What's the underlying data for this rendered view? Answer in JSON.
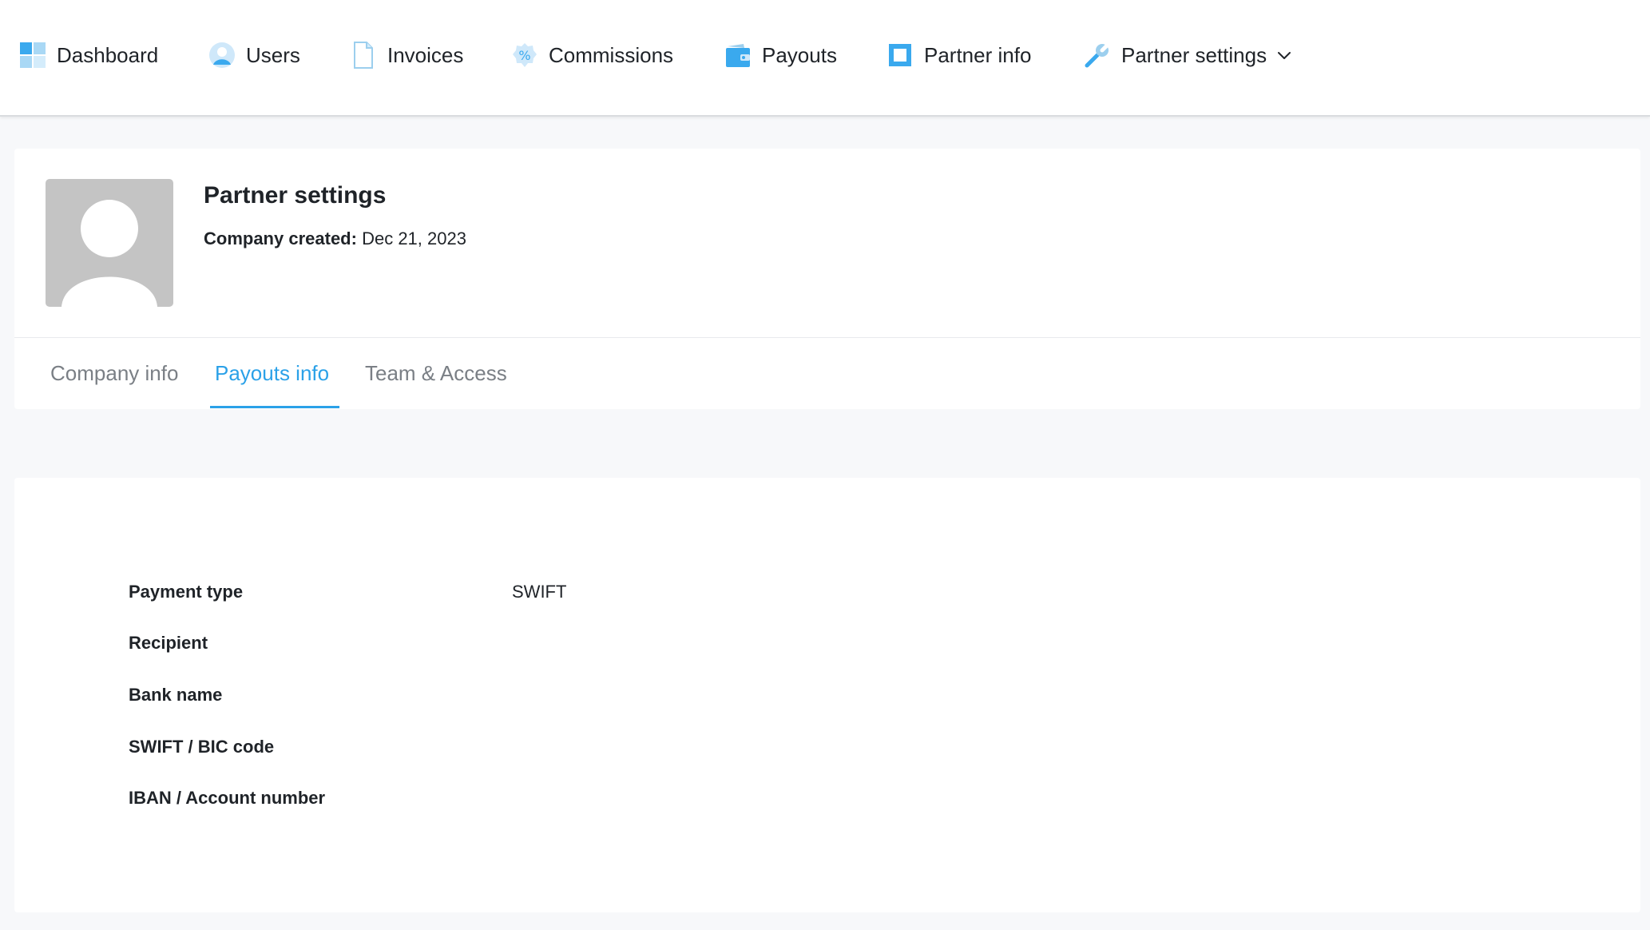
{
  "nav": {
    "items": [
      {
        "label": "Dashboard",
        "icon": "dashboard-grid-icon"
      },
      {
        "label": "Users",
        "icon": "user-icon"
      },
      {
        "label": "Invoices",
        "icon": "document-icon"
      },
      {
        "label": "Commissions",
        "icon": "percent-badge-icon"
      },
      {
        "label": "Payouts",
        "icon": "wallet-icon"
      },
      {
        "label": "Partner info",
        "icon": "square-icon"
      },
      {
        "label": "Partner settings",
        "icon": "wrench-icon",
        "has_dropdown": true
      }
    ]
  },
  "header": {
    "title": "Partner settings",
    "created_label": "Company created:",
    "created_value": "Dec 21, 2023"
  },
  "tabs": [
    {
      "label": "Company info",
      "active": false
    },
    {
      "label": "Payouts info",
      "active": true
    },
    {
      "label": "Team & Access",
      "active": false
    }
  ],
  "payout_fields": [
    {
      "label": "Payment type",
      "value": "SWIFT"
    },
    {
      "label": "Recipient",
      "value": ""
    },
    {
      "label": "Bank name",
      "value": ""
    },
    {
      "label": "SWIFT / BIC code",
      "value": ""
    },
    {
      "label": "IBAN / Account number",
      "value": ""
    }
  ],
  "colors": {
    "accent": "#2ba1e8",
    "icon_blue": "#3aa9ee",
    "avatar_bg": "#c4c4c4"
  }
}
